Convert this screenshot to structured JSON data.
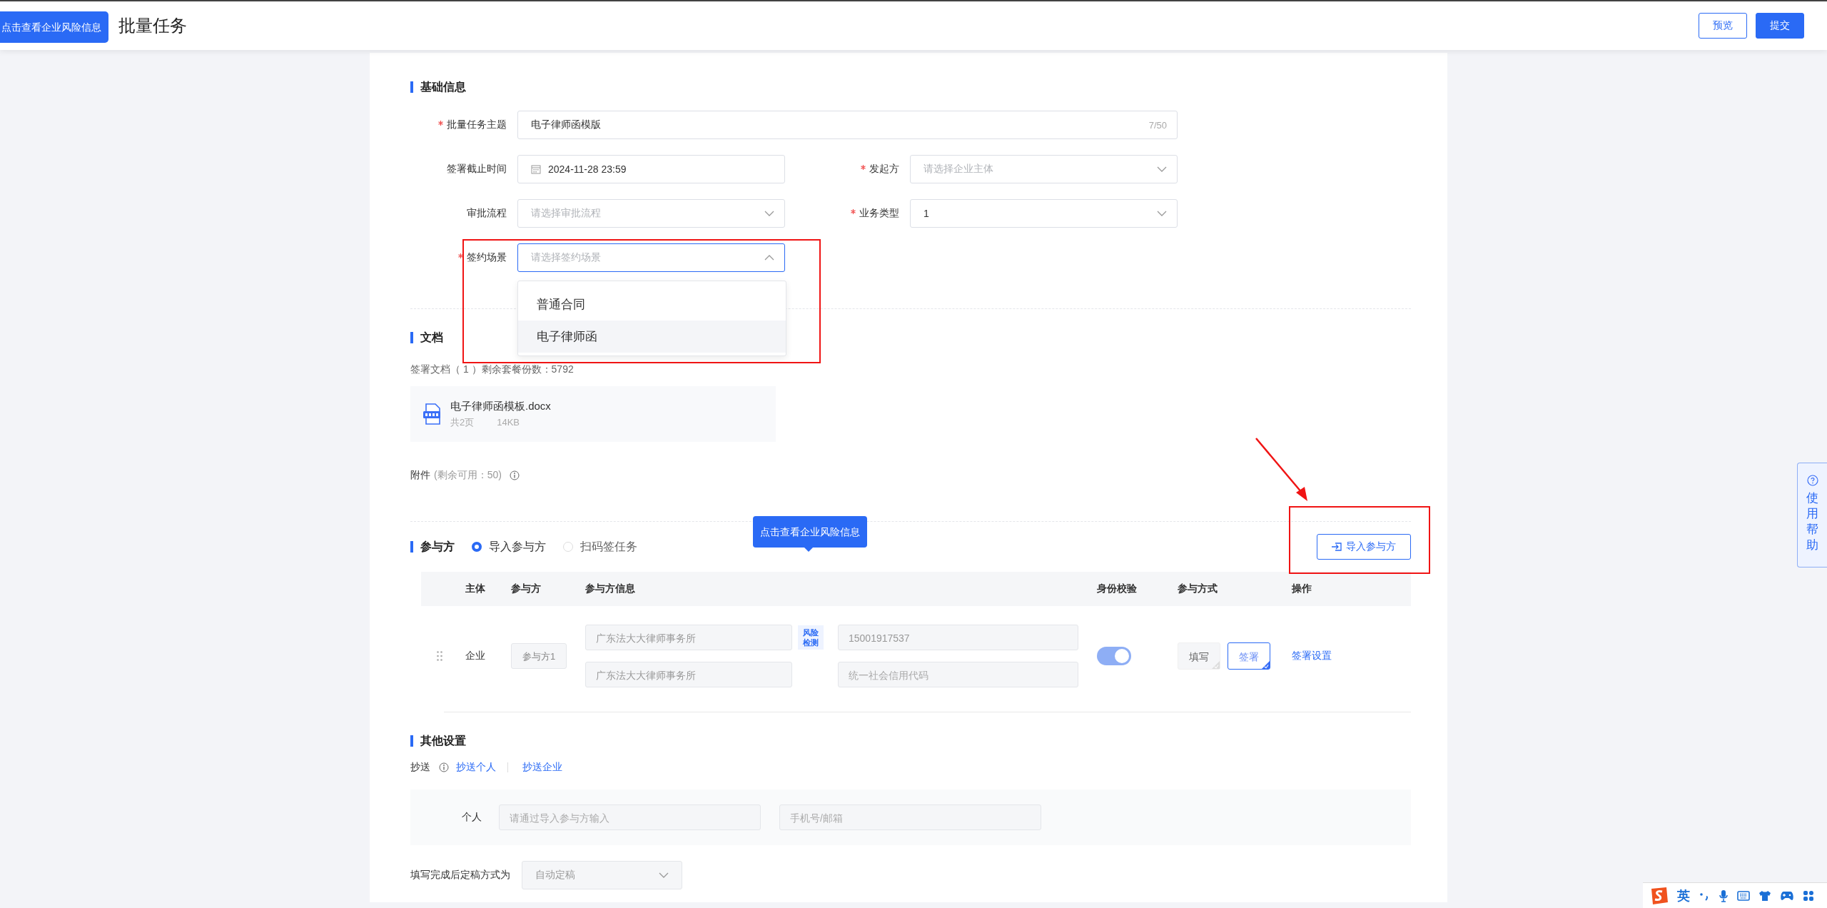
{
  "header": {
    "title": "批量任务",
    "buttons": [
      {
        "label": "预览",
        "kind": "outline"
      },
      {
        "label": "提交",
        "kind": "primary"
      }
    ]
  },
  "top_tooltip": {
    "text": "点击查看企业风险信息"
  },
  "basic_info": {
    "title": "基础信息",
    "rows": [
      {
        "fields": [
          {
            "kind": "text",
            "label": "批量任务主题",
            "required": true,
            "value": "电子律师函模版",
            "counter": "7/50"
          }
        ]
      },
      {
        "fields": [
          {
            "kind": "date",
            "label": "签署截止时间",
            "value": "2024-11-28 23:59"
          },
          {
            "kind": "select",
            "label": "发起方",
            "required": true,
            "placeholder": "请选择企业主体"
          }
        ]
      },
      {
        "fields": [
          {
            "kind": "select",
            "label": "审批流程",
            "placeholder": "请选择审批流程"
          },
          {
            "kind": "select",
            "label": "业务类型",
            "required": true,
            "value": "1"
          }
        ]
      },
      {
        "fields": [
          {
            "kind": "select",
            "label": "签约场景",
            "required": true,
            "placeholder": "请选择签约场景",
            "open": true,
            "options": [
              {
                "label": "普通合同",
                "selected": false
              },
              {
                "label": "电子律师函",
                "selected": true
              }
            ]
          }
        ]
      }
    ]
  },
  "documents": {
    "title": "文档",
    "summary": "签署文档（ 1 ）剩余套餐份数：5792",
    "file": {
      "name": "电子律师函模板.docx",
      "pages": "共2页",
      "size": "14KB"
    },
    "attachment": {
      "label": "附件",
      "note": "(剩余可用：50)"
    }
  },
  "participants": {
    "title": "参与方",
    "modes": [
      {
        "label": "导入参与方",
        "selected": true
      },
      {
        "label": "扫码签任务",
        "selected": false
      }
    ],
    "tooltip": "点击查看企业风险信息",
    "import_button": "导入参与方",
    "columns": [
      "主体",
      "参与方",
      "参与方信息",
      "身份校验",
      "参与方式",
      "操作"
    ],
    "rows": [
      {
        "entity": "企业",
        "party": "参与方1",
        "company": "广东法大大律师事务所",
        "risk_badge": "风险检测",
        "phone": "15001917537",
        "company_name": "广东法大大律师事务所",
        "credit_placeholder": "统一社会信用代码",
        "identity_check": true,
        "methods": [
          {
            "label": "填写",
            "selected": false
          },
          {
            "label": "签署",
            "selected": true
          }
        ],
        "action": "签署设置"
      }
    ]
  },
  "other_settings": {
    "title": "其他设置",
    "cc_label": "抄送",
    "cc_links": [
      "抄送个人",
      "抄送企业"
    ],
    "person": {
      "label": "个人",
      "name_placeholder": "请通过导入参与方输入",
      "contact_placeholder": "手机号/邮箱"
    },
    "finalize": {
      "label": "填写完成后定稿方式为",
      "value": "自动定稿",
      "disabled": true
    }
  },
  "help_tab": {
    "label": "使用帮助"
  },
  "ime_bar": {
    "language": "英"
  }
}
